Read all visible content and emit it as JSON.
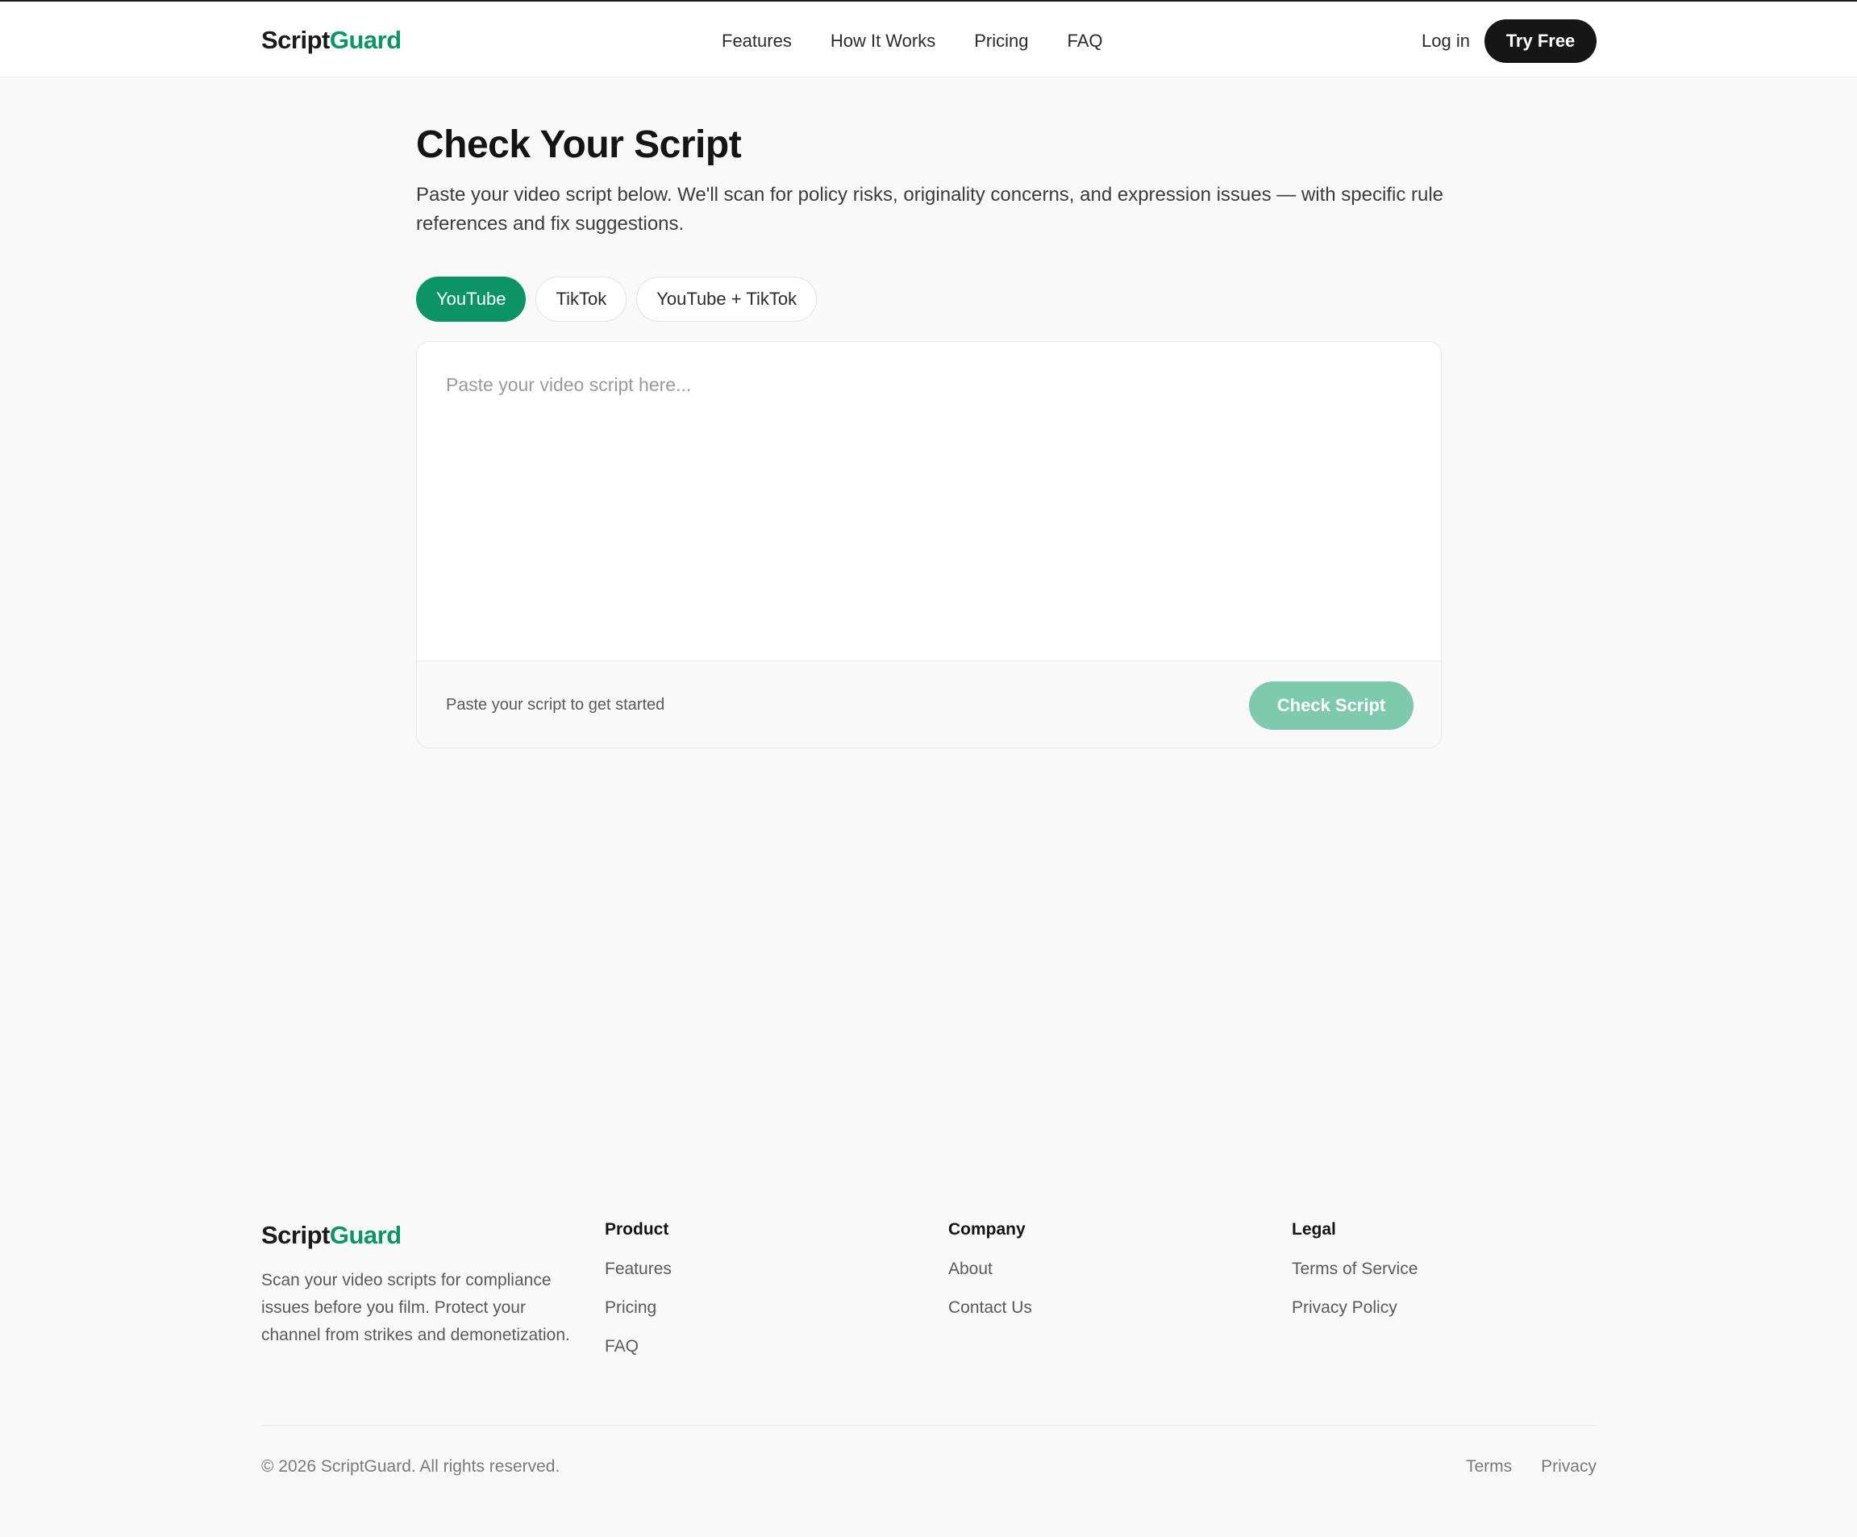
{
  "brand": {
    "name_part1": "Script",
    "name_part2": "Guard"
  },
  "header": {
    "nav": [
      "Features",
      "How It Works",
      "Pricing",
      "FAQ"
    ],
    "login_label": "Log in",
    "try_free_label": "Try Free"
  },
  "main": {
    "title": "Check Your Script",
    "subtitle": "Paste your video script below. We'll scan for policy risks, originality concerns, and expression issues — with specific rule references and fix suggestions.",
    "platform_tabs": [
      "YouTube",
      "TikTok",
      "YouTube + TikTok"
    ],
    "selected_platform": "YouTube",
    "editor": {
      "placeholder": "Paste your video script here...",
      "value": "",
      "hint": "Paste your script to get started",
      "check_button_label": "Check Script"
    }
  },
  "footer": {
    "tagline": "Scan your video scripts for compliance issues before you film. Protect your channel from strikes and demonetization.",
    "columns": [
      {
        "heading": "Product",
        "links": [
          "Features",
          "Pricing",
          "FAQ"
        ]
      },
      {
        "heading": "Company",
        "links": [
          "About",
          "Contact Us"
        ]
      },
      {
        "heading": "Legal",
        "links": [
          "Terms of Service",
          "Privacy Policy"
        ]
      }
    ],
    "copyright": "© 2026 ScriptGuard. All rights reserved.",
    "bottom_links": [
      "Terms",
      "Privacy"
    ]
  },
  "colors": {
    "accent": "#0d9466",
    "accent_disabled": "#7fcaae",
    "dark_button": "#161616",
    "page_background": "#f9f9f9"
  }
}
